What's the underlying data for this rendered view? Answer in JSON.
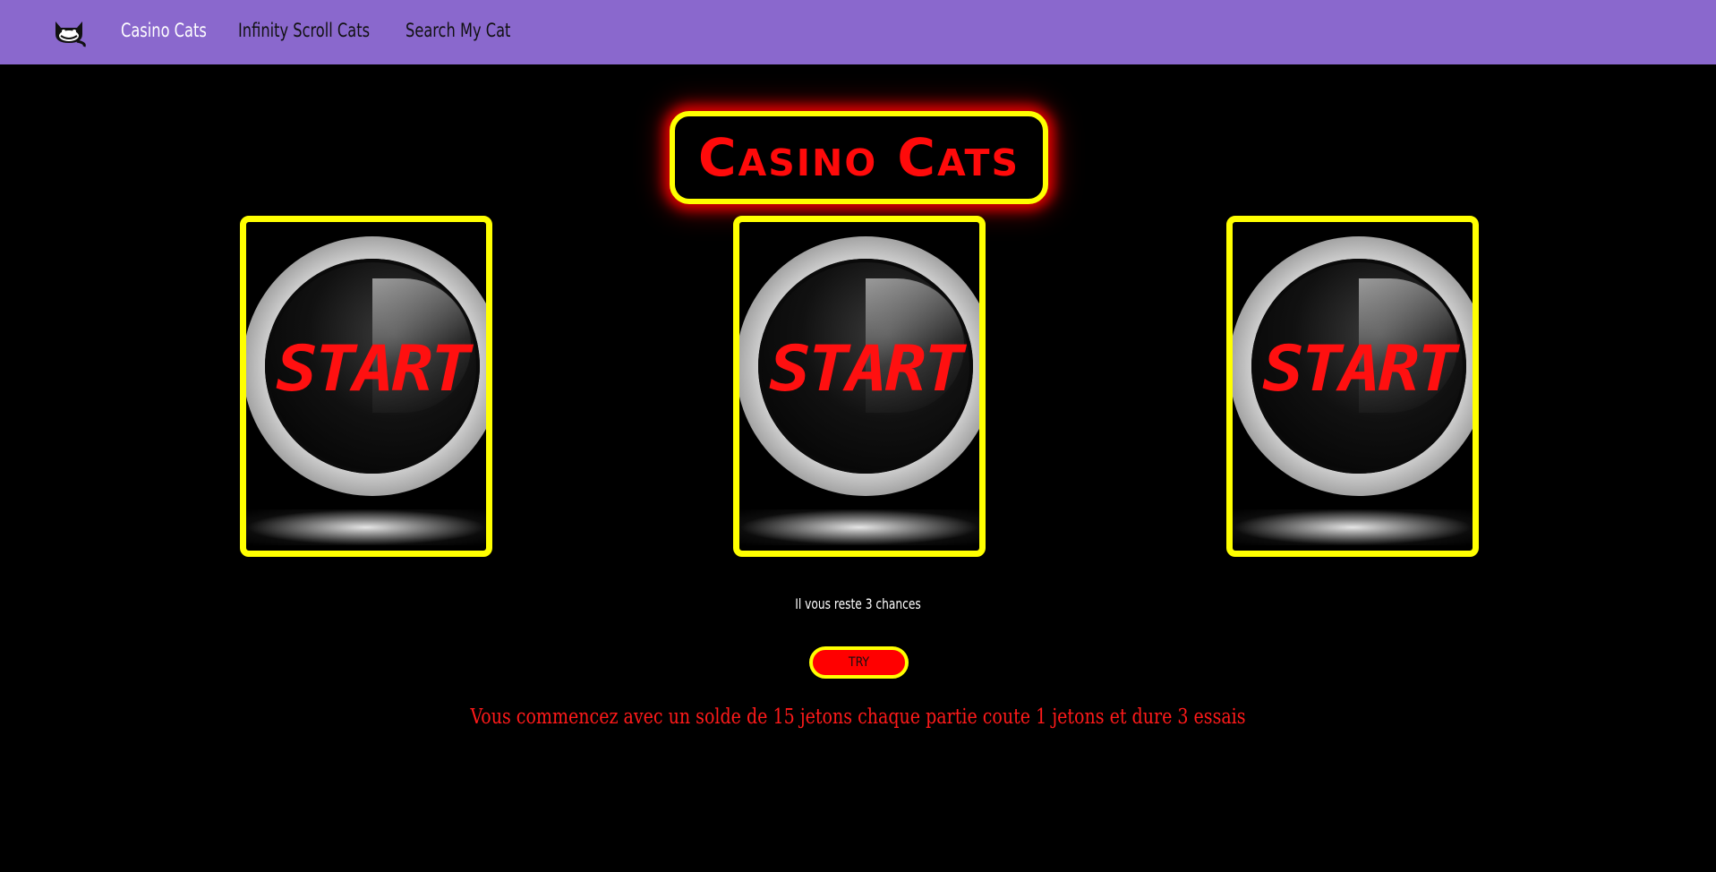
{
  "nav": {
    "logo_icon": "cat-face-icon",
    "links": [
      {
        "label": "Casino Cats",
        "active": true
      },
      {
        "label": "Infinity Scroll Cats",
        "active": false
      },
      {
        "label": "Search My Cat",
        "active": false
      }
    ]
  },
  "game": {
    "title": "Casino Cats",
    "reels": [
      {
        "label": "START"
      },
      {
        "label": "START"
      },
      {
        "label": "START"
      }
    ],
    "chances_text": "Il vous reste 3 chances",
    "try_label": "TRY",
    "info_text": "Vous commencez avec un solde de 15 jetons chaque partie coute 1 jetons et dure 3 essais"
  },
  "colors": {
    "navbar": "#8a68cd",
    "background": "#000000",
    "accent_yellow": "#ffff00",
    "accent_red": "#ff0000"
  }
}
